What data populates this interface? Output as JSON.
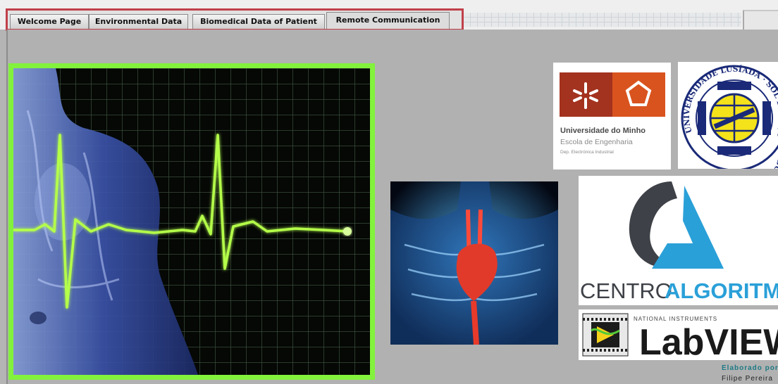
{
  "tabs": [
    {
      "label": "Welcome Page",
      "active": false
    },
    {
      "label": "Environmental Data",
      "active": false
    },
    {
      "label": "Biomedical Data of Patient",
      "active": false
    },
    {
      "label": "Remote Communication",
      "active": true
    }
  ],
  "logos": {
    "uminho": {
      "name": "Universidade do Minho",
      "school": "Escola de Engenharia",
      "dept": "Dep. Electrónica Industrial"
    },
    "lusiada": {
      "ring_text": "UNIVERSIDADE LUSÍADA · SOL LUCET OMNIBUS"
    },
    "centro": {
      "part1": "CENTRO",
      "part2": "ALGORITM"
    },
    "labview": {
      "maker": "NATIONAL INSTRUMENTS",
      "name": "LabVIEW"
    }
  },
  "credits": {
    "label": "Elaborado por:",
    "author": "Filipe Pereira"
  },
  "colors": {
    "ecg_green": "#82f23c",
    "uminho_red": "#a3321f",
    "uminho_orange": "#d9531e",
    "centro_blue": "#2aa0d8",
    "credit_teal": "#1d7a85",
    "frame_red": "#c0404a"
  }
}
